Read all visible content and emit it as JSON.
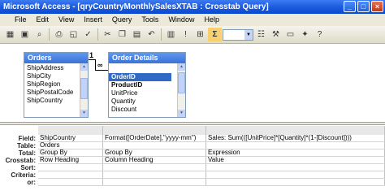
{
  "window": {
    "title": "Microsoft Access - [qryCountryMonthlySalesXTAB : Crosstab Query]"
  },
  "menu": [
    "File",
    "Edit",
    "View",
    "Insert",
    "Query",
    "Tools",
    "Window",
    "Help"
  ],
  "tables": {
    "orders": {
      "name": "Orders",
      "fields": [
        "ShipAddress",
        "ShipCity",
        "ShipRegion",
        "ShipPostalCode",
        "ShipCountry"
      ]
    },
    "order_details": {
      "name": "Order Details",
      "fields": [
        "OrderID",
        "ProductID",
        "UnitPrice",
        "Quantity",
        "Discount"
      ]
    }
  },
  "relationship": {
    "one_side": "1",
    "many_side": "∞"
  },
  "grid": {
    "row_labels": [
      "Field:",
      "Table:",
      "Total:",
      "Crosstab:",
      "Sort:",
      "Criteria:",
      "or:"
    ],
    "columns": [
      {
        "field": "ShipCountry",
        "table": "Orders",
        "total": "Group By",
        "crosstab": "Row Heading",
        "sort": "",
        "criteria": "",
        "or": ""
      },
      {
        "field": "Format([OrderDate],\"yyyy-mm\")",
        "table": "",
        "total": "Group By",
        "crosstab": "Column Heading",
        "sort": "",
        "criteria": "",
        "or": ""
      },
      {
        "field": "Sales: Sum(([UnitPrice]*[Quantity]*(1-[Discount])))",
        "table": "",
        "total": "Expression",
        "crosstab": "Value",
        "sort": "",
        "criteria": "",
        "or": ""
      }
    ]
  }
}
